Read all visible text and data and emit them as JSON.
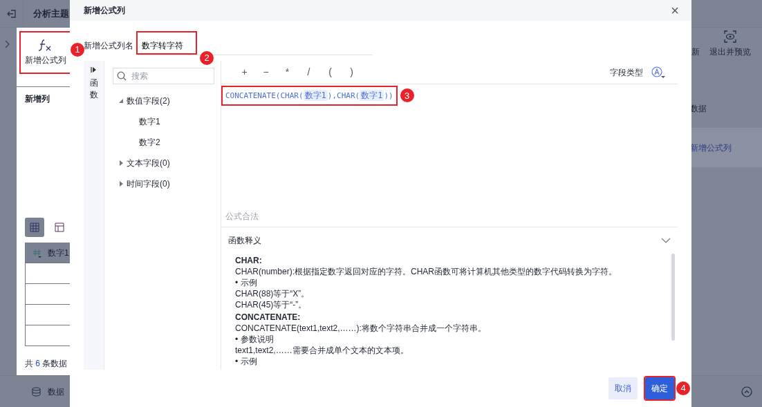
{
  "background": {
    "title": "分析主题",
    "toolbar_button": {
      "label": "新增公式列",
      "step": "1"
    },
    "right_actions": [
      {
        "label": "新",
        "icon": false
      },
      {
        "label": "退出并预览",
        "icon": true
      }
    ],
    "section_title": "新增列",
    "right_list": [
      "数据",
      "新增公式列"
    ],
    "view_toggles": [
      {
        "kind": "grid",
        "selected": true
      },
      {
        "kind": "pivot",
        "selected": false
      }
    ],
    "table": {
      "columns": [
        "数字1"
      ]
    },
    "count": {
      "prefix": "共",
      "value": "6",
      "suffix": "条数据"
    },
    "bottom_tab": "数据"
  },
  "dialog": {
    "title": "新增公式列",
    "close": "×",
    "name_label": "新增公式列名",
    "name_value": "数字转字符",
    "name_step": "2",
    "side_tab": "函数",
    "search": {
      "placeholder": "搜索"
    },
    "tree": [
      {
        "label": "数值字段(2)",
        "expanded": true,
        "children": [
          {
            "label": "数字1"
          },
          {
            "label": "数字2"
          }
        ]
      },
      {
        "label": "文本字段(0)",
        "expanded": false
      },
      {
        "label": "时间字段(0)",
        "expanded": false
      }
    ],
    "operators": [
      "+",
      "−",
      "*",
      "/",
      "(",
      ")"
    ],
    "field_type_label": "字段类型",
    "formula": [
      {
        "kind": "text",
        "text": "CONCATENATE(CHAR("
      },
      {
        "kind": "field",
        "text": "数字1"
      },
      {
        "kind": "text",
        "text": "),CHAR("
      },
      {
        "kind": "field",
        "text": "数字1"
      },
      {
        "kind": "text",
        "text": "))"
      }
    ],
    "formula_step": "3",
    "status": "公式合法",
    "help": {
      "title": "函数释义",
      "expanded": true,
      "lines": [
        {
          "kind": "heading",
          "text": "CHAR:"
        },
        {
          "kind": "text",
          "text": "CHAR(number):根据指定数字返回对应的字符。CHAR函数可将计算机其他类型的数字代码转换为字符。"
        },
        {
          "kind": "text",
          "text": "• 示例"
        },
        {
          "kind": "text",
          "text": "CHAR(88)等于“X”。"
        },
        {
          "kind": "text",
          "text": "CHAR(45)等于“-”。"
        },
        {
          "kind": "heading",
          "text": "CONCATENATE:"
        },
        {
          "kind": "text",
          "text": "CONCATENATE(text1,text2,……):将数个字符串合并成一个字符串。"
        },
        {
          "kind": "text",
          "text": "• 参数说明"
        },
        {
          "kind": "text",
          "text": "text1,text2,……需要合并成单个文本的文本项。"
        },
        {
          "kind": "text",
          "text": "• 示例"
        }
      ]
    },
    "buttons": [
      {
        "label": "取消",
        "kind": "secondary"
      },
      {
        "label": "确定",
        "kind": "primary",
        "step": "4"
      }
    ]
  }
}
